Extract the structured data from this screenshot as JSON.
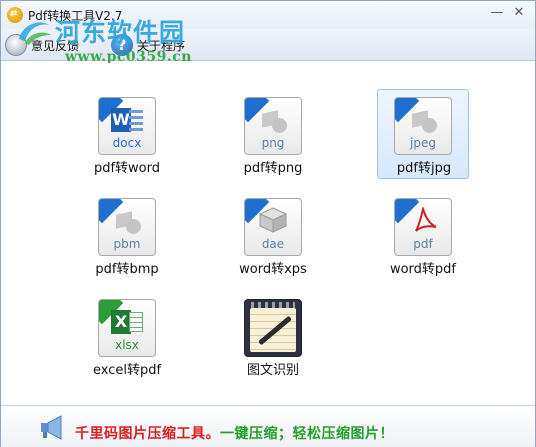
{
  "window": {
    "title": "Pdf转换工具V2.7",
    "minimize_glyph": "—",
    "close_glyph": "✕"
  },
  "watermark": {
    "title": "河东软件园",
    "url": "www.pc0359.cn"
  },
  "toolbar": {
    "feedback_label": "意见反馈",
    "about_label": "关于程序",
    "about_icon_glyph": "?"
  },
  "tools": [
    {
      "ext": "docx",
      "label": "pdf转word",
      "icon": "word-doc-icon"
    },
    {
      "ext": "png",
      "label": "pdf转png",
      "icon": "png-image-icon"
    },
    {
      "ext": "jpeg",
      "label": "pdf转jpg",
      "icon": "jpeg-image-icon",
      "selected": true
    },
    {
      "ext": "pbm",
      "label": "pdf转bmp",
      "icon": "pbm-image-icon"
    },
    {
      "ext": "dae",
      "label": "word转xps",
      "icon": "xps-cube-icon"
    },
    {
      "ext": "pdf",
      "label": "word转pdf",
      "icon": "pdf-acrobat-icon"
    },
    {
      "ext": "xlsx",
      "label": "excel转pdf",
      "icon": "excel-doc-icon"
    },
    {
      "ext": "",
      "label": "图文识别",
      "icon": "notepad-pen-icon"
    }
  ],
  "footer": {
    "promo_part1": "千里码图片压缩工具。",
    "promo_part2": "一键压缩；轻松压缩图片！",
    "icon": "megaphone-icon"
  },
  "colors": {
    "accent_blue": "#1f6fd1",
    "accent_green": "#2f9a3a",
    "promo_red": "#d81e1e",
    "promo_green": "#22a02a"
  }
}
